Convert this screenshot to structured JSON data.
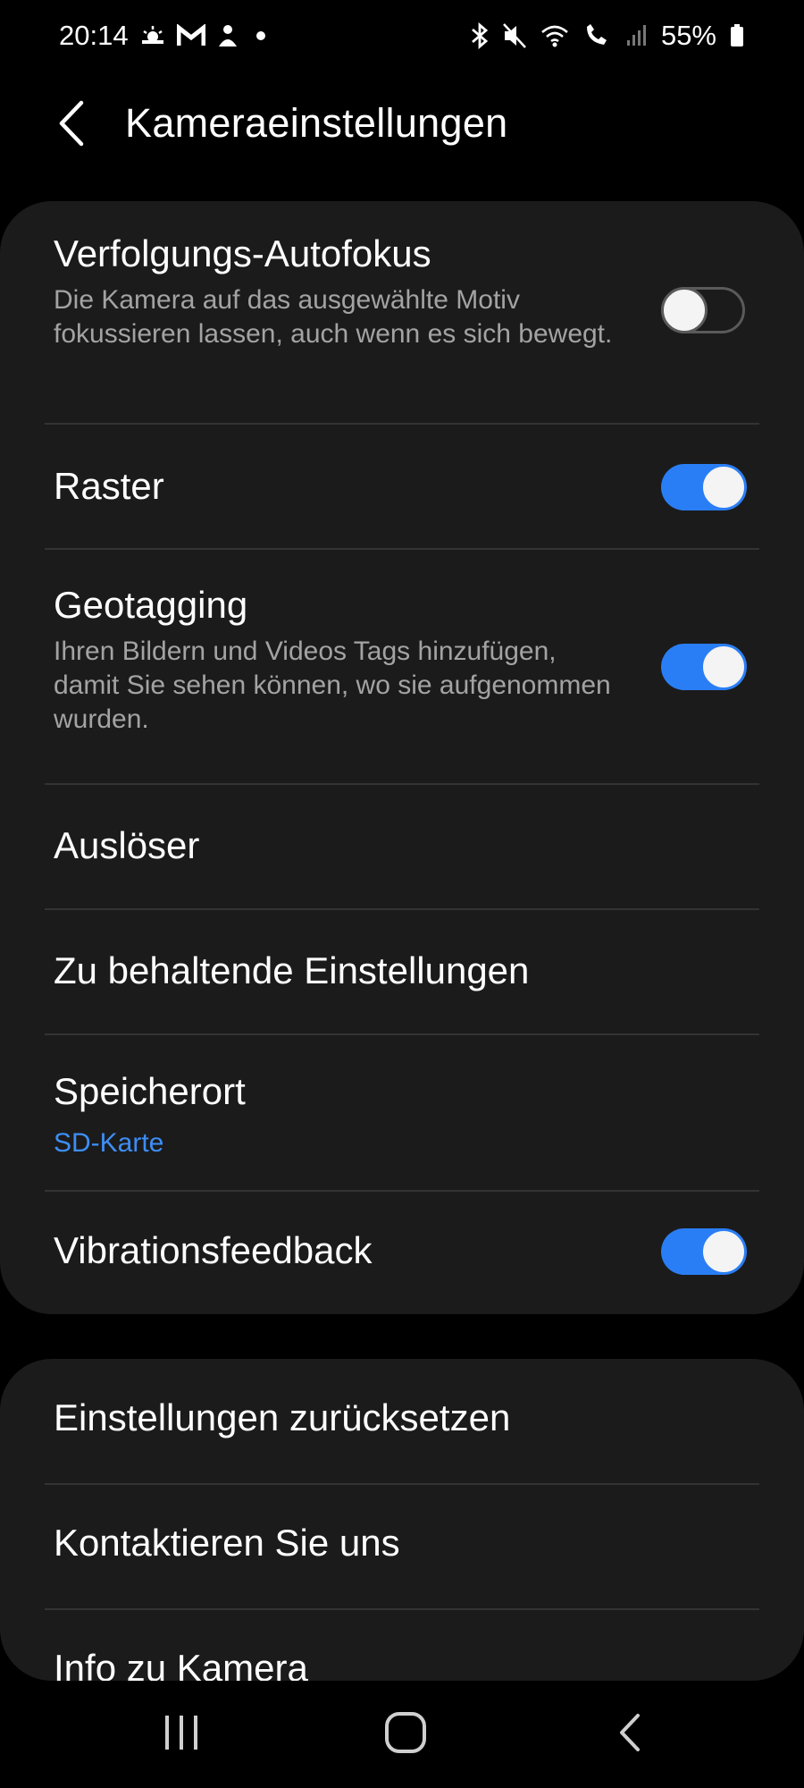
{
  "status_bar": {
    "time": "20:14",
    "battery": "55%",
    "left_icons": [
      "weather-icon",
      "gmail-icon",
      "notification-app-icon",
      "dot-icon"
    ],
    "right_icons": [
      "bluetooth-icon",
      "mute-icon",
      "wifi-icon",
      "wifi-call-icon",
      "signal-icon",
      "battery-icon"
    ]
  },
  "header": {
    "title": "Kameraeinstellungen"
  },
  "settings": {
    "tracking_af": {
      "title": "Verfolgungs-Autofokus",
      "description": "Die Kamera auf das ausgewählte Motiv fokussieren lassen, auch wenn es sich bewegt.",
      "enabled": false
    },
    "grid": {
      "title": "Raster",
      "enabled": true
    },
    "geotagging": {
      "title": "Geotagging",
      "description": "Ihren Bildern und Videos Tags hinzufügen, damit Sie sehen können, wo sie aufgenommen wurden.",
      "enabled": true
    },
    "shutter": {
      "title": "Auslöser"
    },
    "settings_to_keep": {
      "title": "Zu behaltende Einstellungen"
    },
    "storage": {
      "title": "Speicherort",
      "value": "SD-Karte"
    },
    "vibration": {
      "title": "Vibrationsfeedback",
      "enabled": true
    }
  },
  "more": {
    "reset": "Einstellungen zurücksetzen",
    "contact": "Kontaktieren Sie uns",
    "about": "Info zu Kamera"
  },
  "colors": {
    "background": "#000000",
    "card": "#1b1b1b",
    "accent": "#2a7ef5",
    "link": "#3d8ef5",
    "secondary_text": "#a3a3a3"
  }
}
